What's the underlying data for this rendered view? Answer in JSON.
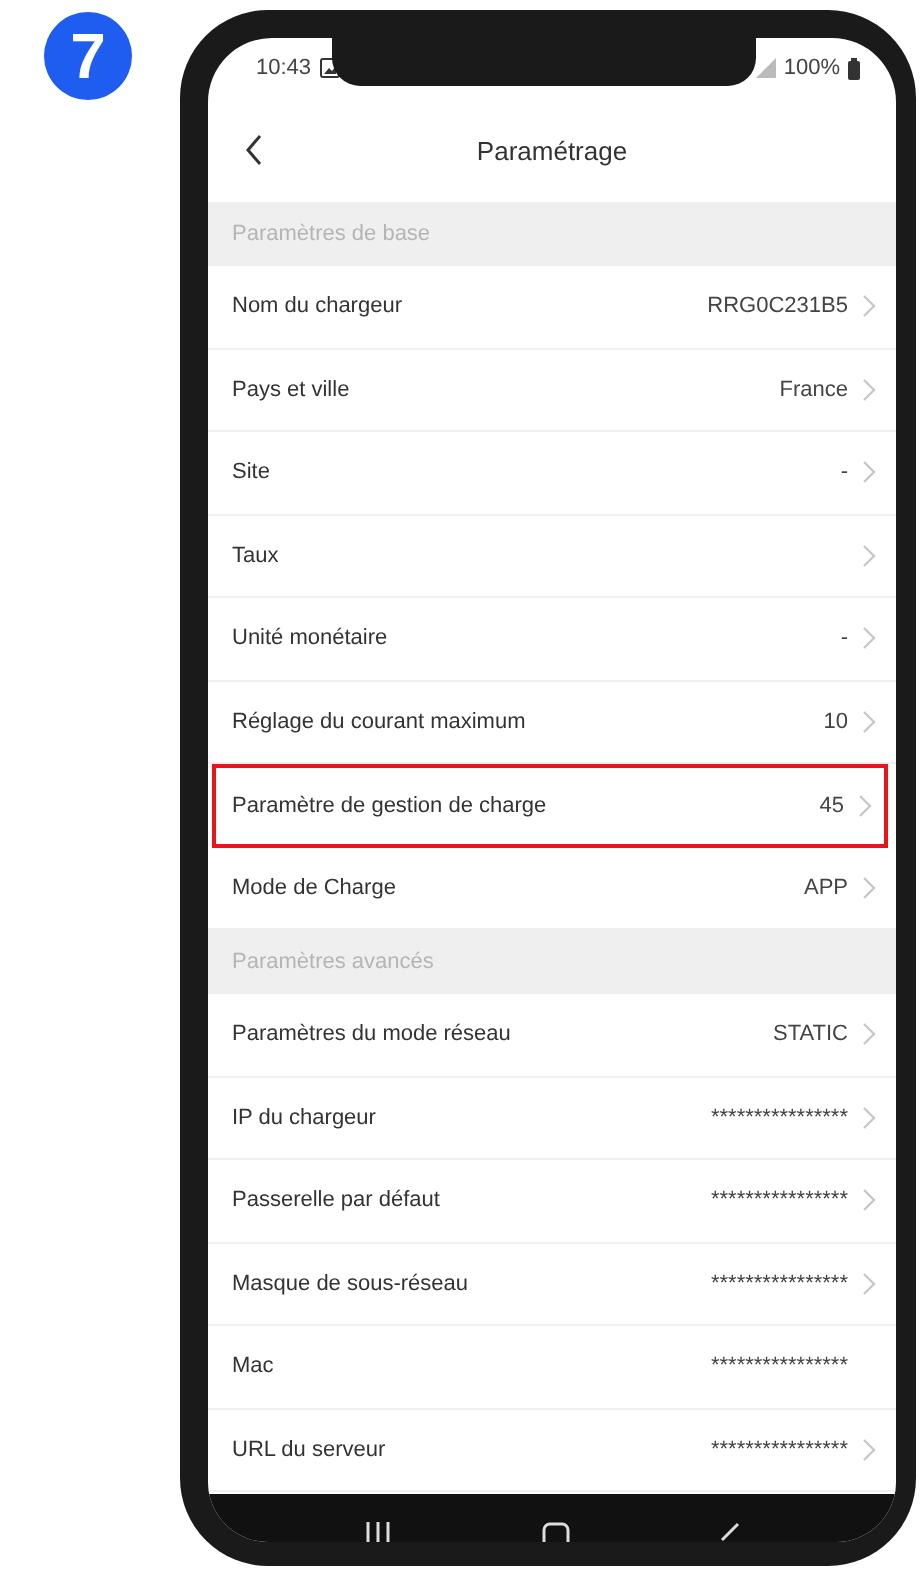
{
  "step_badge": "7",
  "status_bar": {
    "time": "10:43",
    "battery": "100%"
  },
  "header": {
    "title": "Paramétrage"
  },
  "sections": [
    {
      "title": "Paramètres de base",
      "rows": [
        {
          "label": "Nom du chargeur",
          "value": "RRG0C231B5",
          "chevron": true,
          "highlighted": false
        },
        {
          "label": "Pays et ville",
          "value": "France",
          "chevron": true,
          "highlighted": false
        },
        {
          "label": "Site",
          "value": "-",
          "chevron": true,
          "highlighted": false
        },
        {
          "label": "Taux",
          "chevron": true,
          "highlighted": false
        },
        {
          "label": "Unité monétaire",
          "value": "-",
          "chevron": true,
          "highlighted": false
        },
        {
          "label": "Réglage du courant maximum",
          "value": "10",
          "chevron": true,
          "highlighted": false
        },
        {
          "label": "Paramètre de gestion de charge",
          "value": "45",
          "chevron": true,
          "highlighted": true
        },
        {
          "label": "Mode de Charge",
          "value": "APP",
          "chevron": true,
          "highlighted": false
        }
      ]
    },
    {
      "title": "Paramètres avancés",
      "rows": [
        {
          "label": "Paramètres du mode réseau",
          "value": "STATIC",
          "chevron": true,
          "highlighted": false
        },
        {
          "label": "IP du chargeur",
          "value": "****************",
          "chevron": true,
          "highlighted": false
        },
        {
          "label": "Passerelle par défaut",
          "value": "****************",
          "chevron": true,
          "highlighted": false
        },
        {
          "label": "Masque de sous-réseau",
          "value": "****************",
          "chevron": true,
          "highlighted": false
        },
        {
          "label": "Mac",
          "value": "****************",
          "chevron": false,
          "highlighted": false
        },
        {
          "label": "URL du serveur",
          "value": "****************",
          "chevron": true,
          "highlighted": false
        }
      ]
    }
  ]
}
